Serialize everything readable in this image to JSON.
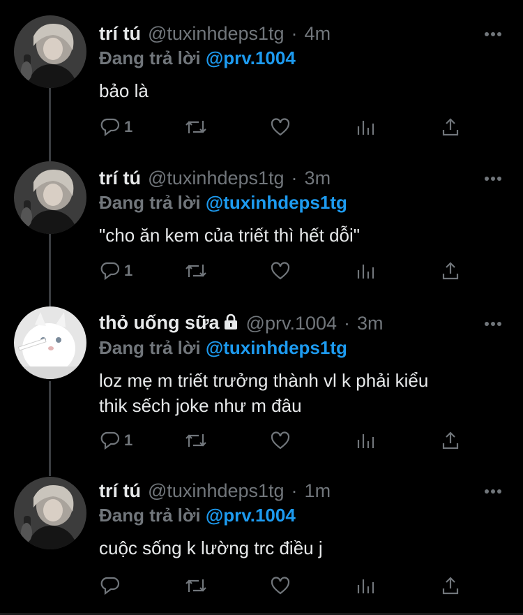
{
  "colors": {
    "background": "#000000",
    "name": "#e7e9ea",
    "muted": "#71767b",
    "link": "#1d9bf0"
  },
  "tweets": [
    {
      "name": "trí tú",
      "handle": "@tuxinhdeps1tg",
      "dot": "·",
      "time": "4m",
      "replying_label": "Đang trả lời",
      "replying_to": "@prv.1004",
      "text": "bảo là",
      "reply_count": "1",
      "avatar": "person-photo",
      "locked": false
    },
    {
      "name": "trí tú",
      "handle": "@tuxinhdeps1tg",
      "dot": "·",
      "time": "3m",
      "replying_label": "Đang trả lời",
      "replying_to": "@tuxinhdeps1tg",
      "text": "\"cho ăn kem của triết thì hết dỗi\"",
      "reply_count": "1",
      "avatar": "person-photo",
      "locked": false
    },
    {
      "name": "thỏ uống sữa",
      "handle": "@prv.1004",
      "dot": "·",
      "time": "3m",
      "replying_label": "Đang trả lời",
      "replying_to": "@tuxinhdeps1tg",
      "text_lines": [
        "loz mẹ m triết trưởng thành vl k phải kiểu",
        "thik sếch joke như m đâu"
      ],
      "reply_count": "1",
      "avatar": "white-cat-photo",
      "locked": true
    },
    {
      "name": "trí tú",
      "handle": "@tuxinhdeps1tg",
      "dot": "·",
      "time": "1m",
      "replying_label": "Đang trả lời",
      "replying_to": "@prv.1004",
      "text": "cuộc sống k lường trc điều j",
      "reply_count": "",
      "avatar": "person-photo",
      "locked": false
    }
  ],
  "icons": {
    "reply": "reply-icon",
    "retweet": "retweet-icon",
    "like": "like-icon",
    "views": "views-icon",
    "share": "share-icon",
    "more": "more-icon",
    "lock": "lock-icon"
  }
}
